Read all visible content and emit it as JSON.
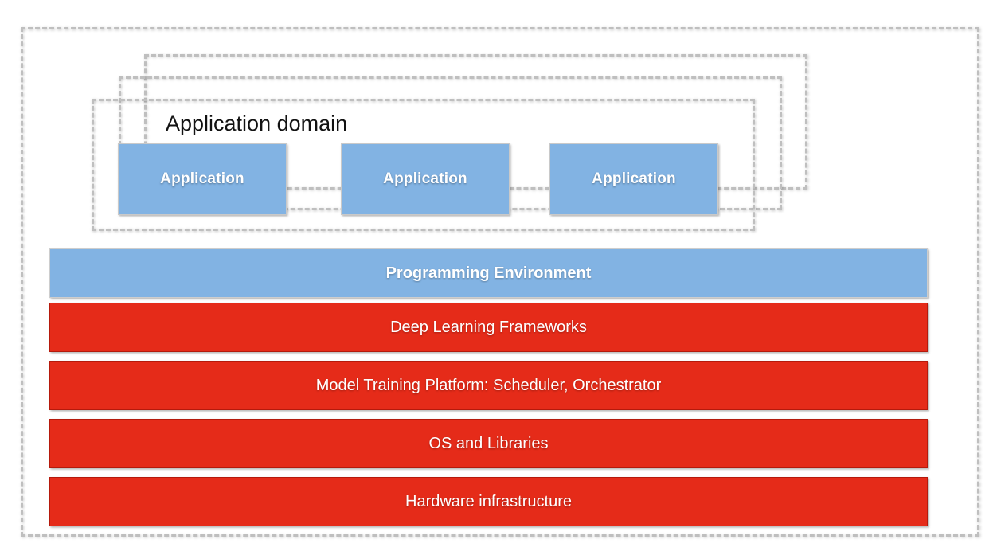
{
  "diagram": {
    "title_text": "Application domain",
    "outer_frame_name": "outer-system-boundary",
    "colors": {
      "app_blue": "#82B3E3",
      "layer_red": "#E52B19",
      "layer_red_border": "#B51A0C",
      "dashed_gray": "#BFBFBF",
      "text_white": "#FFFFFF",
      "text_black": "#121212"
    },
    "application_domain": {
      "label": "Application domain",
      "frame_count": 3,
      "applications": [
        {
          "label": "Application"
        },
        {
          "label": "Application"
        },
        {
          "label": "Application"
        }
      ]
    },
    "layers": [
      {
        "label": "Programming Environment",
        "color": "#82B3E3",
        "emphasis": "bold"
      },
      {
        "label": "Deep Learning Frameworks",
        "color": "#E52B19",
        "emphasis": "regular"
      },
      {
        "label": "Model Training Platform: Scheduler, Orchestrator",
        "color": "#E52B19",
        "emphasis": "regular"
      },
      {
        "label": "OS and Libraries",
        "color": "#E52B19",
        "emphasis": "regular"
      },
      {
        "label": "Hardware infrastructure",
        "color": "#E52B19",
        "emphasis": "regular"
      }
    ]
  }
}
